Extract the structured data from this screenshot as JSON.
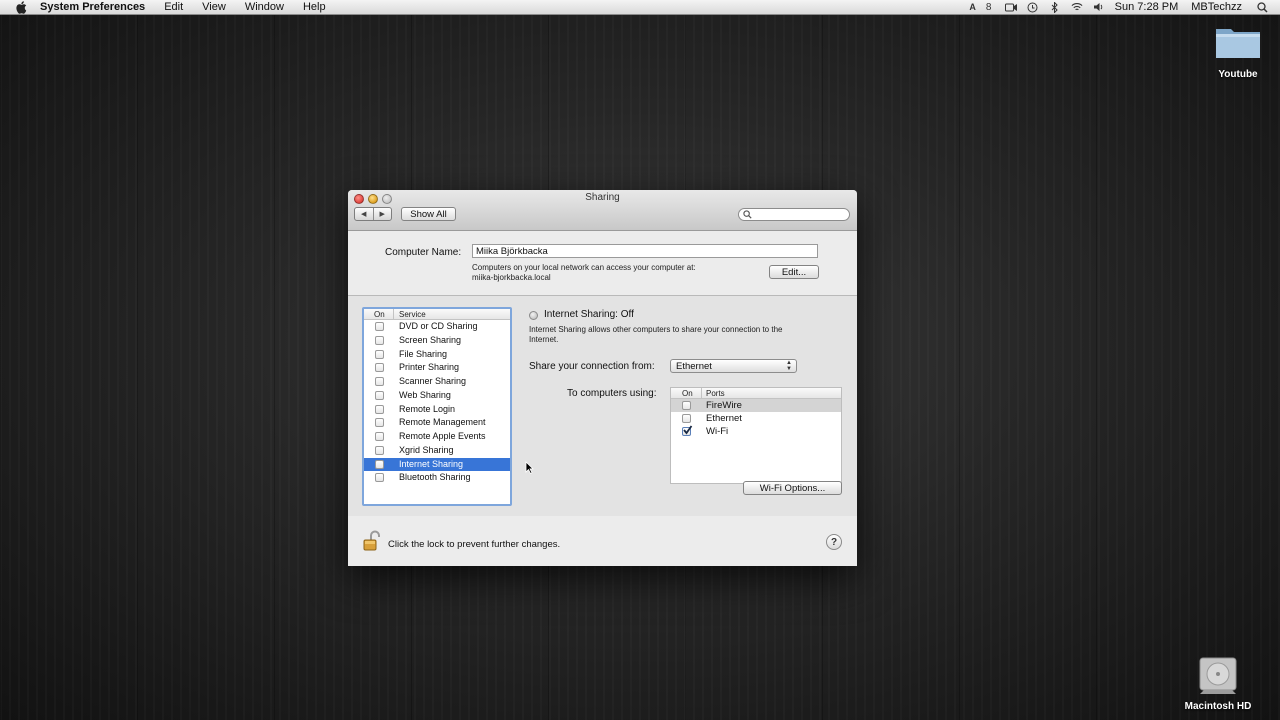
{
  "menubar": {
    "app_name": "System Preferences",
    "items": [
      "Edit",
      "View",
      "Window",
      "Help"
    ],
    "status": {
      "battery_digit": "8",
      "clock": "Sun 7:28 PM",
      "user": "MBTechzz"
    }
  },
  "desktop": {
    "folder_label": "Youtube",
    "drive_label": "Macintosh HD"
  },
  "window": {
    "title": "Sharing",
    "show_all": "Show All",
    "search_placeholder": "",
    "computer_name_label": "Computer Name:",
    "computer_name_value": "Miika Björkbacka",
    "access_note_line1": "Computers on your local network can access your computer at:",
    "access_note_line2": "miika-bjorkbacka.local",
    "edit_button": "Edit...",
    "service_list": {
      "col_on": "On",
      "col_service": "Service",
      "items": [
        {
          "name": "DVD or CD Sharing",
          "checked": false
        },
        {
          "name": "Screen Sharing",
          "checked": false
        },
        {
          "name": "File Sharing",
          "checked": false
        },
        {
          "name": "Printer Sharing",
          "checked": false
        },
        {
          "name": "Scanner Sharing",
          "checked": false
        },
        {
          "name": "Web Sharing",
          "checked": false
        },
        {
          "name": "Remote Login",
          "checked": false
        },
        {
          "name": "Remote Management",
          "checked": false
        },
        {
          "name": "Remote Apple Events",
          "checked": false
        },
        {
          "name": "Xgrid Sharing",
          "checked": false
        },
        {
          "name": "Internet Sharing",
          "checked": false,
          "selected": true
        },
        {
          "name": "Bluetooth Sharing",
          "checked": false
        }
      ]
    },
    "detail": {
      "status_title": "Internet Sharing: Off",
      "description_line1": "Internet Sharing allows other computers to share your connection to the",
      "description_line2": "Internet.",
      "share_from_label": "Share your connection from:",
      "share_from_value": "Ethernet",
      "to_computers_label": "To computers using:",
      "ports_col_on": "On",
      "ports_col_ports": "Ports",
      "ports": [
        {
          "name": "FireWire",
          "checked": false
        },
        {
          "name": "Ethernet",
          "checked": false
        },
        {
          "name": "Wi-Fi",
          "checked": true
        }
      ],
      "wifi_options_button": "Wi-Fi Options..."
    },
    "lock_text": "Click the lock to prevent further changes.",
    "help_symbol": "?"
  },
  "colors": {
    "selection": "#3875d7",
    "list_focus": "#7ea6dc",
    "close": "#e0443e",
    "minimize": "#dea123",
    "zoom_inactive": "#c7c7c7"
  }
}
